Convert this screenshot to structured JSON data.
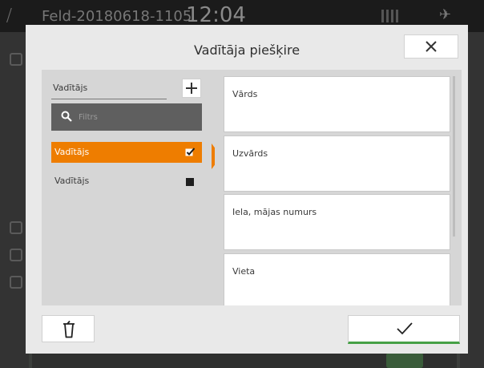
{
  "background": {
    "title": "Feld-20180618-1105",
    "time": "12:04"
  },
  "dialog": {
    "title": "Vadītāja piešķire",
    "close_icon": "close-icon",
    "list": {
      "header": "Vadītājs",
      "add_icon": "plus-icon",
      "search": {
        "placeholder": "Filtrs",
        "value": "",
        "icon": "search-icon"
      },
      "items": [
        {
          "label": "Vadītājs",
          "selected": true,
          "state_icon": "checkmark-icon"
        },
        {
          "label": "Vadītājs",
          "selected": false,
          "state_icon": "square-icon"
        }
      ]
    },
    "details": {
      "fields": [
        {
          "label": "Vārds"
        },
        {
          "label": "Uzvārds"
        },
        {
          "label": "Iela, mājas numurs"
        },
        {
          "label": "Vieta"
        }
      ]
    },
    "footer": {
      "delete_icon": "trash-icon",
      "confirm_icon": "checkmark-icon"
    }
  },
  "colors": {
    "accent": "#ee7d00",
    "confirm_underline": "#46a046",
    "dialog_bg": "#e9e9e9",
    "panel_bg": "#d6d6d6",
    "search_bg": "#5f5f5f"
  }
}
